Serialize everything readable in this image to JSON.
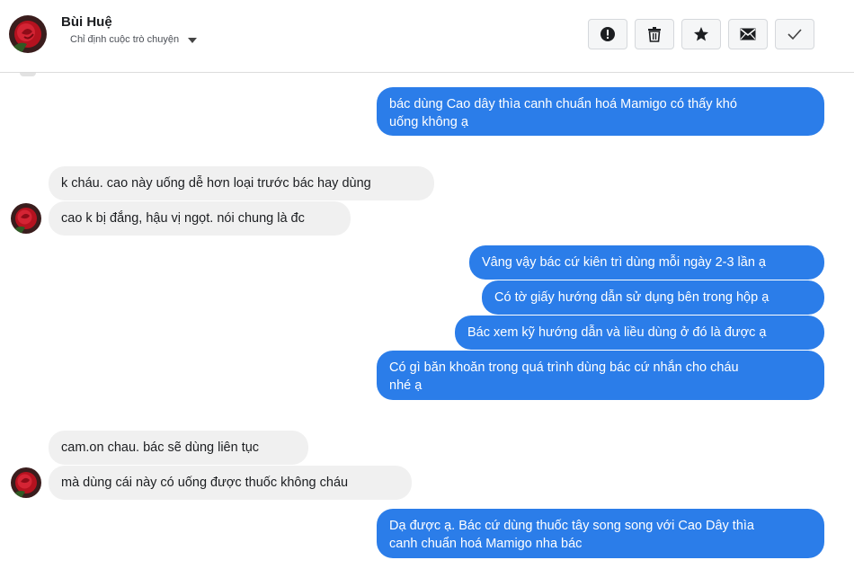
{
  "header": {
    "contact_name": "Bùi Huệ",
    "assign_label": "Chỉ định cuộc trò chuyện",
    "actions": [
      {
        "icon": "alert-icon",
        "label": "Mark as spam"
      },
      {
        "icon": "trash-icon",
        "label": "Delete"
      },
      {
        "icon": "star-icon",
        "label": "Star"
      },
      {
        "icon": "envelope-icon",
        "label": "Mark as unread"
      },
      {
        "icon": "check-icon",
        "label": "Mark as done"
      }
    ]
  },
  "colors": {
    "outgoing_bubble": "#2b7de9",
    "incoming_bubble": "#f0f0f0",
    "avatar_red": "#c0182a"
  },
  "messages": [
    {
      "dir": "out",
      "text": "bác dùng Cao dây thìa canh chuẩn hoá Mamigo có thấy khó\nuống không ạ"
    },
    {
      "dir": "in",
      "text": "k cháu. cao này uống dễ hơn loại trước bác hay dùng"
    },
    {
      "dir": "in",
      "text": "cao k bị đắng, hậu vị ngọt. nói chung là đc"
    },
    {
      "dir": "out",
      "text": "Vâng vậy bác cứ kiên trì dùng mỗi ngày 2-3 lần ạ"
    },
    {
      "dir": "out",
      "text": "Có tờ giấy hướng dẫn sử dụng bên trong hộp ạ"
    },
    {
      "dir": "out",
      "text": "Bác xem kỹ hướng dẫn và liều dùng ở đó là được ạ"
    },
    {
      "dir": "out",
      "text": "Có gì băn khoăn trong quá trình dùng bác cứ nhắn cho cháu\nnhé ạ"
    },
    {
      "dir": "in",
      "text": "cam.on chau. bác sẽ dùng liên tục"
    },
    {
      "dir": "in",
      "text": "mà dùng cái này có uống được thuốc không cháu"
    },
    {
      "dir": "out",
      "text": "Dạ được ạ. Bác cứ dùng thuốc tây song song với Cao Dây thìa\ncanh chuẩn hoá Mamigo nha bác"
    }
  ]
}
